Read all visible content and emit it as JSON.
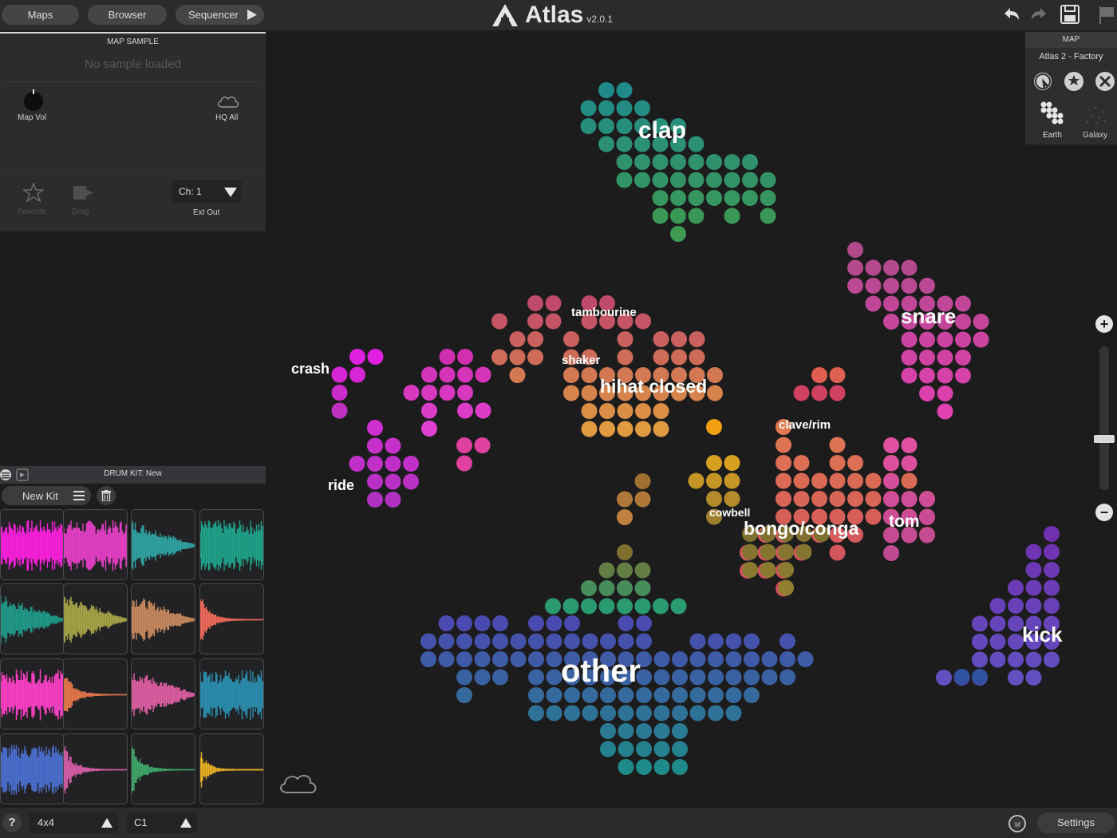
{
  "app": {
    "title": "Atlas",
    "version": "v2.0.1"
  },
  "topnav": {
    "maps": "Maps",
    "browser": "Browser",
    "sequencer": "Sequencer"
  },
  "map_sample": {
    "title": "MAP SAMPLE",
    "status": "No sample loaded",
    "map_vol": "Map Vol",
    "hq_all": "HQ All",
    "favorite": "Favorite",
    "drag": "Drag",
    "channel": "Ch: 1",
    "ext_out": "Ext Out"
  },
  "drum_kit": {
    "title": "DRUM KIT: New",
    "new_kit": "New Kit"
  },
  "pads": [
    {
      "color": "#ff1fe0"
    },
    {
      "color": "#e83fc8"
    },
    {
      "color": "#2fa3a3"
    },
    {
      "color": "#1ea38a"
    },
    {
      "color": "#1f9b8a"
    },
    {
      "color": "#a7a547"
    },
    {
      "color": "#c88a5f"
    },
    {
      "color": "#f06a5a"
    },
    {
      "color": "#ff3fc8"
    },
    {
      "color": "#e7784b"
    },
    {
      "color": "#df5fa3"
    },
    {
      "color": "#2a8fb0"
    },
    {
      "color": "#4b6fd0"
    },
    {
      "color": "#d85fa8"
    },
    {
      "color": "#3fa86a"
    },
    {
      "color": "#e8b020"
    }
  ],
  "map_panel": {
    "title": "MAP",
    "name": "Atlas 2 - Factory",
    "earth": "Earth",
    "galaxy": "Galaxy"
  },
  "map_labels": {
    "clap": "clap",
    "snare": "snare",
    "tambourine": "tambourine",
    "shaker": "shaker",
    "hihat_closed": "hihat closed",
    "crash": "crash",
    "ride": "ride",
    "clave_rim": "clave/rim",
    "cowbell": "cowbell",
    "bongo_conga": "bongo/conga",
    "tom": "tom",
    "kick": "kick",
    "other": "other"
  },
  "bottom": {
    "help": "?",
    "grid": "4x4",
    "note": "C1",
    "settings": "Settings"
  }
}
